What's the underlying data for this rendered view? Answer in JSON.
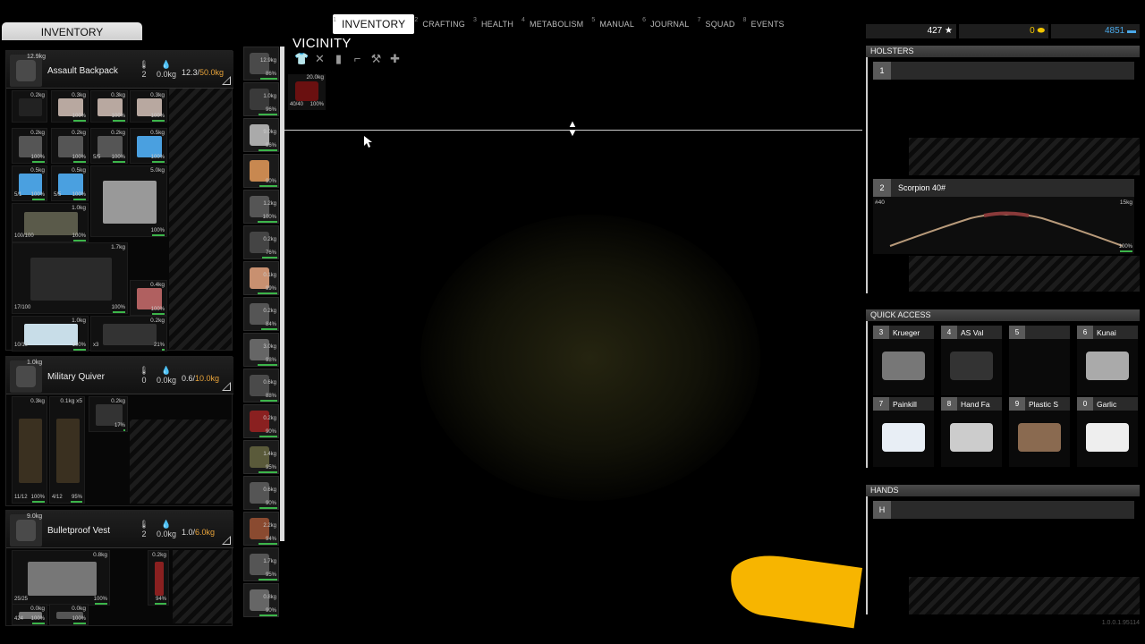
{
  "tabs": [
    {
      "num": "1",
      "label": "INVENTORY",
      "active": true
    },
    {
      "num": "2",
      "label": "CRAFTING"
    },
    {
      "num": "3",
      "label": "HEALTH"
    },
    {
      "num": "4",
      "label": "METABOLISM"
    },
    {
      "num": "5",
      "label": "MANUAL"
    },
    {
      "num": "6",
      "label": "JOURNAL"
    },
    {
      "num": "7",
      "label": "SQUAD"
    },
    {
      "num": "8",
      "label": "EVENTS"
    }
  ],
  "inventory_title": "INVENTORY",
  "containers": [
    {
      "name": "Assault Backpack",
      "kg": "12.9kg",
      "temp": "2",
      "water": "0.0kg",
      "weight": "12.3/",
      "capacity": "50.0kg"
    },
    {
      "name": "Military Quiver",
      "kg": "1.0kg",
      "temp": "0",
      "water": "0.0kg",
      "weight": "0.6/",
      "capacity": "10.0kg"
    },
    {
      "name": "Bulletproof Vest",
      "kg": "9.0kg",
      "temp": "2",
      "water": "0.0kg",
      "weight": "1.0/",
      "capacity": "6.0kg"
    }
  ],
  "backpack_items": [
    {
      "kg": "0.2kg",
      "pct": "",
      "cnt": ""
    },
    {
      "kg": "0.3kg",
      "pct": "100%",
      "cnt": ""
    },
    {
      "kg": "0.3kg",
      "pct": "100%",
      "cnt": ""
    },
    {
      "kg": "0.3kg",
      "pct": "100%",
      "cnt": ""
    },
    {
      "kg": "0.2kg",
      "pct": "100%",
      "cnt": ""
    },
    {
      "kg": "0.2kg",
      "pct": "100%",
      "cnt": ""
    },
    {
      "kg": "0.2kg",
      "pct": "100%",
      "cnt": "5/5"
    },
    {
      "kg": "0.5kg",
      "pct": "100%",
      "cnt": ""
    },
    {
      "kg": "0.5kg",
      "pct": "100%",
      "cnt": "5/1"
    },
    {
      "kg": "0.5kg",
      "pct": "100%",
      "cnt": "5/5"
    },
    {
      "kg": "5.0kg",
      "pct": "100%",
      "cnt": ""
    },
    {
      "kg": "1.0kg",
      "pct": "100%",
      "cnt": "100/100"
    },
    {
      "kg": "1.7kg",
      "pct": "100%",
      "cnt": "17/100"
    },
    {
      "kg": "0.4kg",
      "pct": "100%",
      "cnt": ""
    },
    {
      "kg": "1.0kg",
      "pct": "100%",
      "cnt": "10/10"
    },
    {
      "kg": "0.2kg",
      "pct": "21%",
      "cnt": "x3"
    }
  ],
  "quiver_items": [
    {
      "kg": "0.3kg",
      "pct": "100%",
      "cnt": "11/12"
    },
    {
      "kg": "0.1kg x5",
      "pct": "95%",
      "cnt": "4/12"
    },
    {
      "kg": "0.2kg",
      "pct": "17%",
      "cnt": ""
    }
  ],
  "vest_items": [
    {
      "kg": "0.8kg",
      "pct": "100%",
      "cnt": "25/25"
    },
    {
      "kg": "0.2kg",
      "pct": "94%",
      "cnt": ""
    },
    {
      "kg": "0.0kg",
      "pct": "100%",
      "cnt": "424"
    },
    {
      "kg": "0.0kg",
      "pct": "100%",
      "cnt": ""
    }
  ],
  "strip_items": [
    {
      "kg": "12.9kg",
      "pct": "86%"
    },
    {
      "kg": "1.0kg",
      "pct": "96%"
    },
    {
      "kg": "9.0kg",
      "pct": "96%"
    },
    {
      "kg": "",
      "pct": "90%"
    },
    {
      "kg": "1.2kg",
      "pct": "100%"
    },
    {
      "kg": "0.2kg",
      "pct": "76%"
    },
    {
      "kg": "0.1kg",
      "pct": "99%"
    },
    {
      "kg": "0.2kg",
      "pct": "84%"
    },
    {
      "kg": "3.0kg",
      "pct": "98%"
    },
    {
      "kg": "0.6kg",
      "pct": "88%"
    },
    {
      "kg": "0.2kg",
      "pct": "90%"
    },
    {
      "kg": "1.4kg",
      "pct": "95%"
    },
    {
      "kg": "0.6kg",
      "pct": "90%"
    },
    {
      "kg": "2.2kg",
      "pct": "94%"
    },
    {
      "kg": "1.7kg",
      "pct": "95%"
    },
    {
      "kg": "0.8kg",
      "pct": "90%"
    }
  ],
  "vicinity": {
    "title": "VICINITY",
    "item": {
      "kg": "20.0kg",
      "count": "40/40",
      "pct": "100%"
    }
  },
  "stats": {
    "points": "427 ★",
    "gold": "0",
    "money": "4851"
  },
  "holsters": {
    "title": "HOLSTERS",
    "slot1": {
      "num": "1",
      "label": ""
    },
    "slot2": {
      "num": "2",
      "label": "Scorpion 40#",
      "left": "#40",
      "right": "15kg",
      "pct": "100%"
    }
  },
  "quick_access": {
    "title": "QUICK ACCESS",
    "slots": [
      {
        "num": "3",
        "label": "Krueger"
      },
      {
        "num": "4",
        "label": "AS Val"
      },
      {
        "num": "5",
        "label": ""
      },
      {
        "num": "6",
        "label": "Kunai"
      },
      {
        "num": "7",
        "label": "Painkill"
      },
      {
        "num": "8",
        "label": "Hand Fa"
      },
      {
        "num": "9",
        "label": "Plastic S"
      },
      {
        "num": "0",
        "label": "Garlic"
      }
    ]
  },
  "hands": {
    "title": "HANDS",
    "slot": "H"
  },
  "version": "1.0.0.1.95114",
  "colors": {
    "accent_orange": "#e8a33a",
    "health_green": "#3cb54a",
    "money_blue": "#4aa8e8",
    "gold_yellow": "#f2c500"
  }
}
